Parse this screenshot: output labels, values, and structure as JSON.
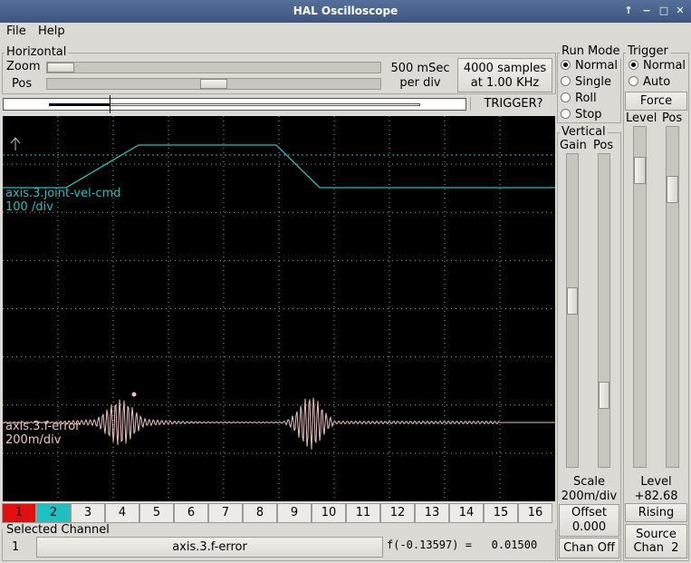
{
  "window": {
    "title": "HAL Oscilloscope"
  },
  "menu": {
    "file": "File",
    "help": "Help"
  },
  "horizontal": {
    "label": "Horizontal",
    "zoom_label": "Zoom",
    "pos_label": "Pos",
    "time_line1": "500 mSec",
    "time_line2": "per div",
    "samples_line1": "4000 samples",
    "samples_line2": "at 1.00 KHz",
    "trigger_status": "TRIGGER?"
  },
  "run_mode": {
    "label": "Run Mode",
    "options": [
      "Normal",
      "Single",
      "Roll",
      "Stop"
    ],
    "selected": "Normal"
  },
  "trigger": {
    "label": "Trigger",
    "options": [
      "Normal",
      "Auto"
    ],
    "selected": "Normal",
    "force": "Force",
    "level_label": "Level",
    "pos_label": "Pos",
    "level_title": "Level",
    "level_value": "+82.68",
    "edge": "Rising",
    "source_line1": "Source",
    "source_line2": "Chan  2"
  },
  "vertical": {
    "label": "Vertical",
    "gain_label": "Gain",
    "pos_label": "Pos",
    "scale_title": "Scale",
    "scale_value": "200m/div",
    "offset_line1": "Offset",
    "offset_line2": "0.000",
    "chan_off": "Chan Off"
  },
  "traces": [
    {
      "name": "axis.3.joint-vel-cmd",
      "scale": "100 /div",
      "color": "#20c0c0"
    },
    {
      "name": "axis.3.f-error",
      "scale": "200m/div",
      "color": "#f0c0c0"
    }
  ],
  "channels": [
    "1",
    "2",
    "3",
    "4",
    "5",
    "6",
    "7",
    "8",
    "9",
    "10",
    "11",
    "12",
    "13",
    "14",
    "15",
    "16"
  ],
  "channel_colors": {
    "1": "#e01010",
    "2": "#20c0c0"
  },
  "selected_channel": {
    "label": "Selected Channel",
    "number": "1",
    "name": "axis.3.f-error",
    "readout": "f(-0.13597) =   0.01500"
  }
}
